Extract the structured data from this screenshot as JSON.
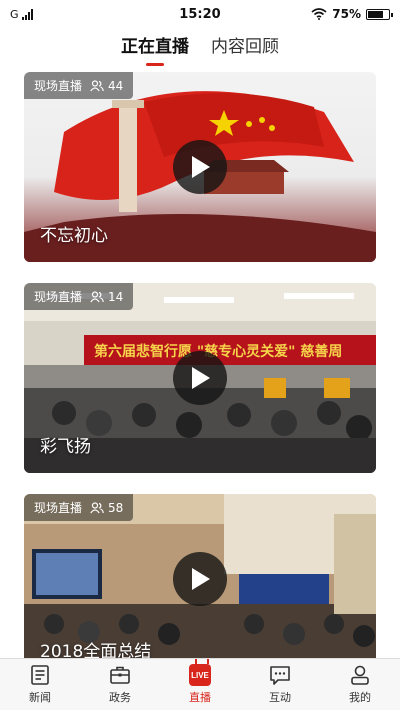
{
  "status_bar": {
    "carrier": "G",
    "time": "15:20",
    "battery": "75%",
    "battery_level": 0.75
  },
  "tabs": [
    {
      "label": "正在直播",
      "active": true
    },
    {
      "label": "内容回顾",
      "active": false
    }
  ],
  "cards": [
    {
      "badge": "现场直播",
      "viewers": "44",
      "title": "不忘初心"
    },
    {
      "badge": "现场直播",
      "viewers": "14",
      "title": "彩飞扬"
    },
    {
      "badge": "现场直播",
      "viewers": "58",
      "title": "2018全面总结"
    }
  ],
  "bottom_nav": [
    {
      "label": "新闻",
      "icon": "document-icon"
    },
    {
      "label": "政务",
      "icon": "briefcase-icon"
    },
    {
      "label": "直播",
      "icon": "live-icon",
      "badge": "LIVE",
      "active": true
    },
    {
      "label": "互动",
      "icon": "chat-icon"
    },
    {
      "label": "我的",
      "icon": "user-icon"
    }
  ],
  "colors": {
    "accent": "#d9261c"
  }
}
